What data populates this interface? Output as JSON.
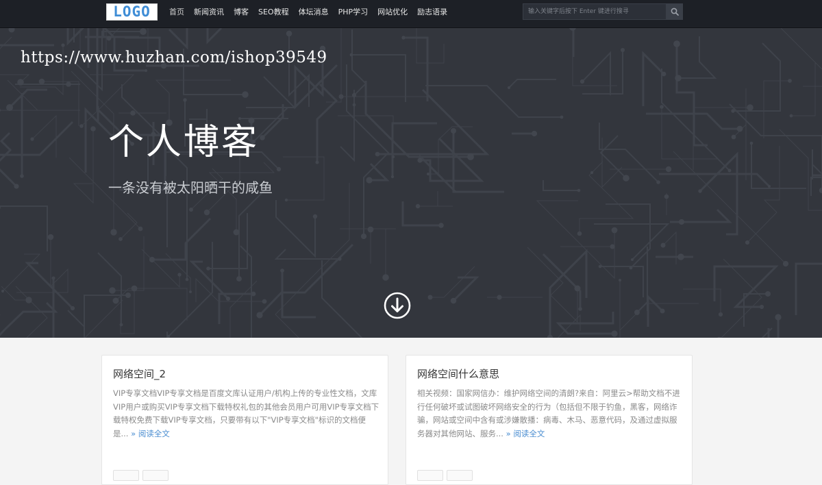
{
  "header": {
    "logo_text": "LOGO",
    "nav": [
      "首页",
      "新闻资讯",
      "博客",
      "SEO教程",
      "体坛消息",
      "PHP学习",
      "网站优化",
      "励志语录"
    ],
    "search_placeholder": "输入关键字后按下 Enter 键进行搜寻",
    "search_icon": "search-icon"
  },
  "hero": {
    "watermark": "https://www.huzhan.com/ishop39549",
    "title": "个人博客",
    "subtitle": "一条没有被太阳晒干的咸鱼",
    "scroll_icon": "arrow-down-circle-icon"
  },
  "posts": [
    {
      "title": "网络空间_2",
      "excerpt": "VIP专享文档VIP专享文档是百度文库认证用户/机构上传的专业性文档，文库VIP用户或购买VIP专享文档下载特权礼包的其他会员用户可用VIP专享文档下载特权免费下载VIP专享文档，只要带有以下\"VIP专享文档\"标识的文档便是...",
      "more": "» 阅读全文"
    },
    {
      "title": "网络空间什么意思",
      "excerpt": "相关视频：国家网信办：维护网络空间的清朗?来自：阿里云>帮助文档不进行任何破坏或试图破坏网络安全的行为（包括但不限于钓鱼，黑客，网络诈骗，网站或空间中含有或涉嫌散播：病毒、木马、恶意代码，及通过虚拟服务器对其他网站、服务...",
      "more": "» 阅读全文"
    }
  ],
  "colors": {
    "topbar": "#1d2026",
    "hero": "#33363d",
    "logo_text": "#3f8dd6",
    "link": "#4b8ed1",
    "excerpt": "#8a8a8a"
  }
}
